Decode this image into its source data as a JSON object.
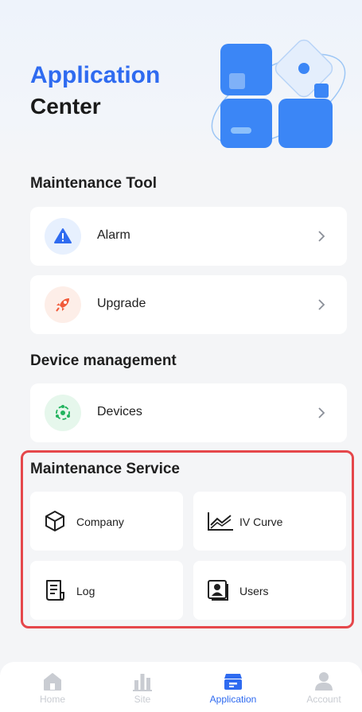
{
  "header": {
    "title_line1": "Application",
    "title_line2": "Center"
  },
  "sections": {
    "maintenance_tool": "Maintenance Tool",
    "device_management": "Device management",
    "maintenance_service": "Maintenance Service"
  },
  "tool_items": [
    {
      "label": "Alarm",
      "icon": "alarm-icon"
    },
    {
      "label": "Upgrade",
      "icon": "rocket-icon"
    }
  ],
  "device_items": [
    {
      "label": "Devices",
      "icon": "devices-icon"
    }
  ],
  "service_items": [
    {
      "label": "Company",
      "icon": "company-icon"
    },
    {
      "label": "IV Curve",
      "icon": "iv-curve-icon"
    },
    {
      "label": "Log",
      "icon": "log-icon"
    },
    {
      "label": "Users",
      "icon": "users-icon"
    }
  ],
  "tabbar": [
    {
      "label": "Home",
      "icon": "home-icon",
      "active": false
    },
    {
      "label": "Site",
      "icon": "site-icon",
      "active": false
    },
    {
      "label": "Application",
      "icon": "application-icon",
      "active": true
    },
    {
      "label": "Account",
      "icon": "account-icon",
      "active": false
    }
  ],
  "colors": {
    "accent": "#2f6bf0",
    "highlight_border": "#e5474b",
    "background": "#f4f5f7"
  }
}
